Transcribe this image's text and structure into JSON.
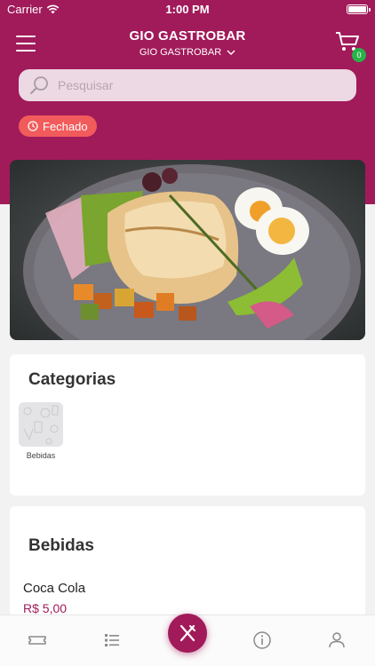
{
  "status_bar": {
    "carrier": "Carrier",
    "time": "1:00 PM"
  },
  "header": {
    "title": "GIO GASTROBAR",
    "store_selector": "GIO GASTROBAR",
    "cart_count": "0"
  },
  "search": {
    "placeholder": "Pesquisar",
    "value": ""
  },
  "store_status": {
    "label": "Fechado",
    "color": "#f25b5b"
  },
  "colors": {
    "brand": "#a11a5a",
    "badge": "#27b24a",
    "background": "#f2f2f3"
  },
  "banner": {
    "image": "grilled-fish-dish-photo"
  },
  "categories": {
    "title": "Categorias",
    "items": [
      {
        "label": "Bebidas"
      }
    ]
  },
  "section": {
    "title": "Bebidas",
    "products": [
      {
        "name": "Coca Cola",
        "price": "R$ 5,00"
      }
    ]
  },
  "tabbar": {
    "tabs": [
      {
        "icon": "ticket-icon"
      },
      {
        "icon": "list-icon"
      },
      {
        "icon": "fork-knife-icon",
        "active": true
      },
      {
        "icon": "info-icon"
      },
      {
        "icon": "user-icon"
      }
    ]
  }
}
